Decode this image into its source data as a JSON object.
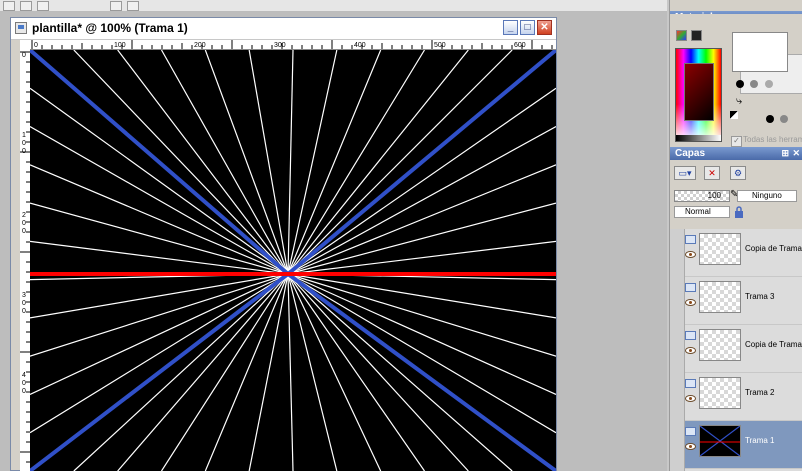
{
  "document": {
    "title": "plantilla* @ 100% (Trama 1)",
    "ruler_h_labels": [
      "0",
      "100",
      "200",
      "300",
      "400",
      "500",
      "600"
    ],
    "ruler_v_labels": [
      "0",
      "100",
      "200",
      "300",
      "400"
    ],
    "canvas": {
      "background": "#000000",
      "ray_color": "#ffffff",
      "diagonal_color": "#3050c8",
      "horizontal_color": "#ff0000"
    }
  },
  "materials": {
    "title": "Materiales",
    "all_tools_label": "Todas las herrami"
  },
  "layers": {
    "title": "Capas",
    "opacity": "100",
    "mask": "Ninguno",
    "blend_mode": "Normal",
    "items": [
      {
        "name": "Copia de Trama",
        "selected": false
      },
      {
        "name": "Trama 3",
        "selected": false
      },
      {
        "name": "Copia de Trama",
        "selected": false
      },
      {
        "name": "Trama 2",
        "selected": false
      },
      {
        "name": "Trama 1",
        "selected": true
      }
    ]
  }
}
